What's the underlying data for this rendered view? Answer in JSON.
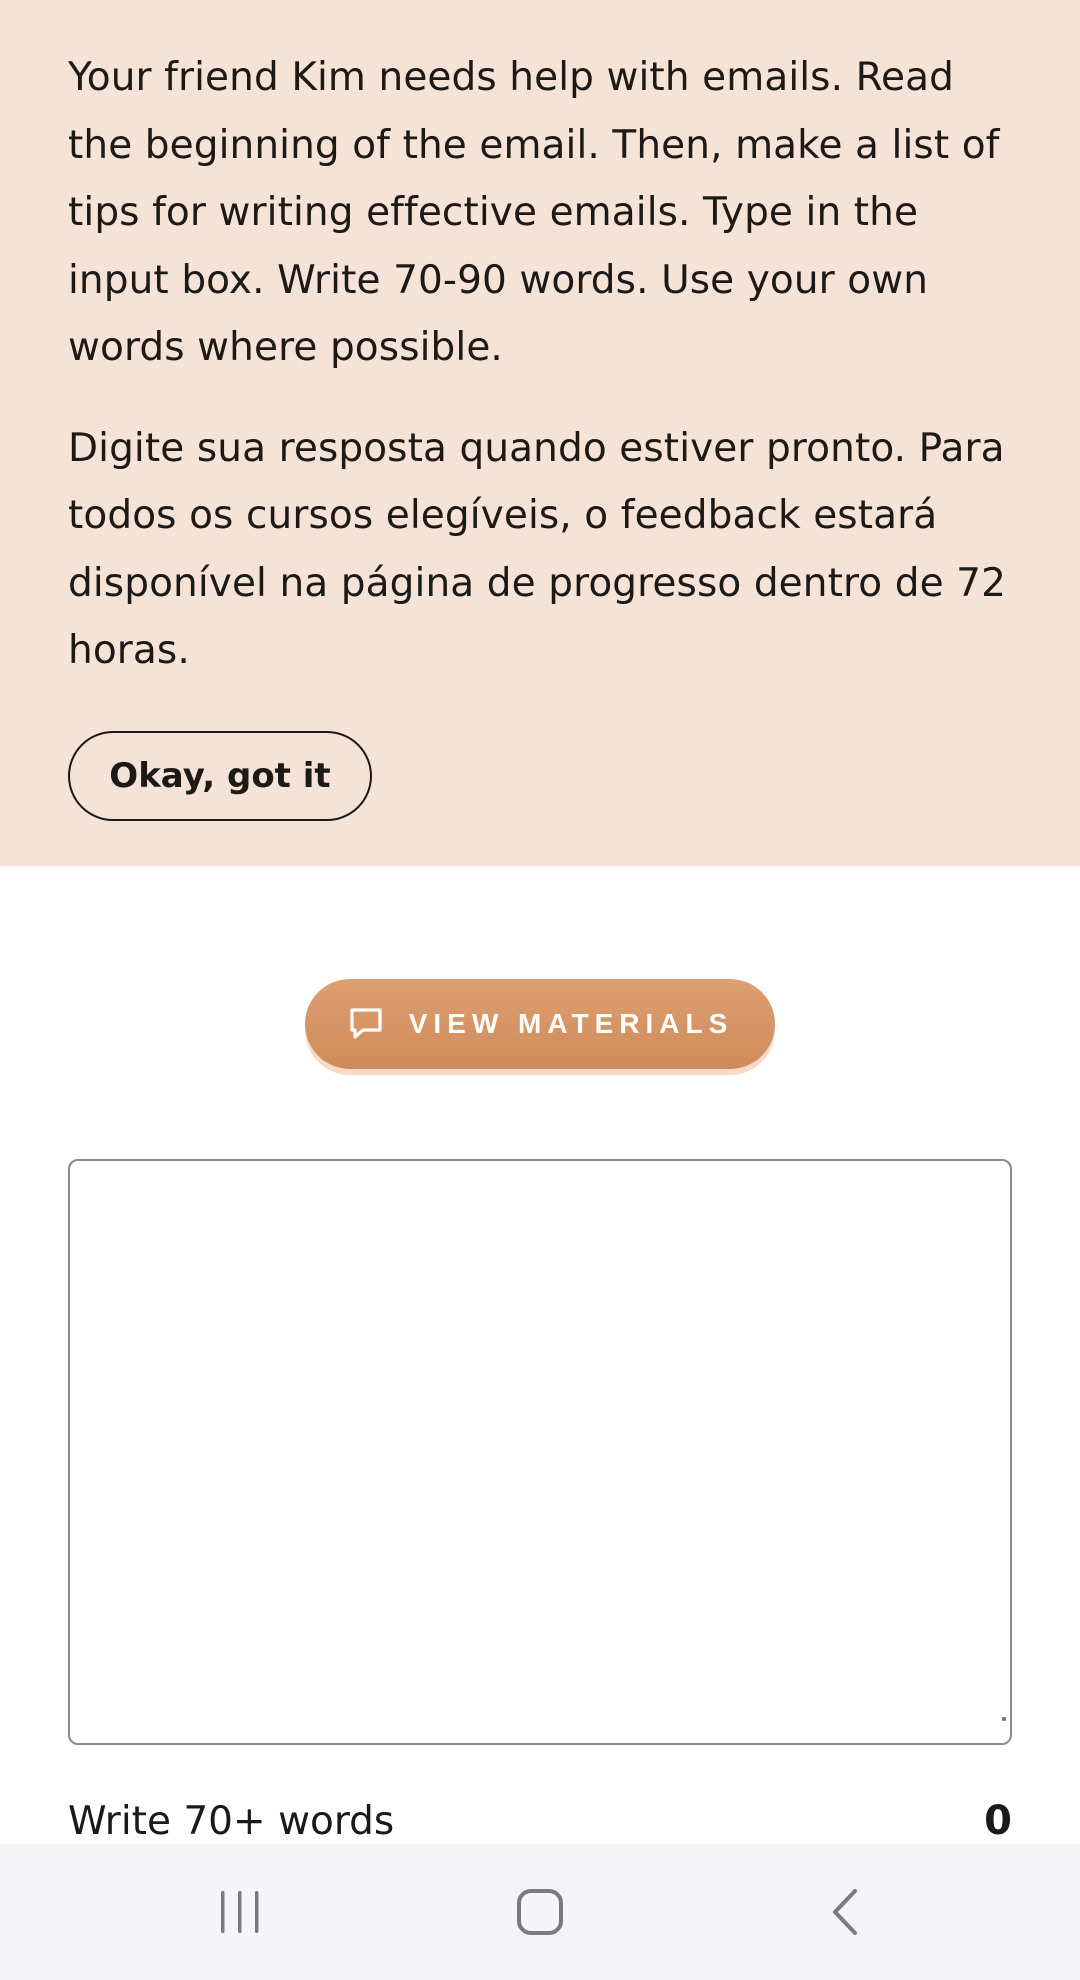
{
  "instructions": {
    "paragraph_en": "Your friend Kim needs help with emails. Read the beginning of the email. Then, make a list of tips for writing effective emails. Type in the input box. Write 70-90 words. Use your own words where possible.",
    "paragraph_pt": "Digite sua resposta quando estiver pronto. Para todos os cursos elegíveis, o feedback estará disponível na página de progresso dentro de 72 horas.",
    "ok_label": "Okay, got it"
  },
  "materials": {
    "label": "VIEW MATERIALS",
    "icon": "chat-bubble-icon"
  },
  "answer": {
    "value": ""
  },
  "footer": {
    "requirement": "Write 70+ words",
    "word_count": "0"
  },
  "navigation": {
    "recent_icon": "recent-apps-icon",
    "home_icon": "home-icon",
    "back_icon": "back-icon"
  },
  "colors": {
    "instructions_bg": "#f6e3d7",
    "accent": "#d4905f",
    "text": "#1c1917",
    "nav_bg": "#f5f5f7"
  }
}
